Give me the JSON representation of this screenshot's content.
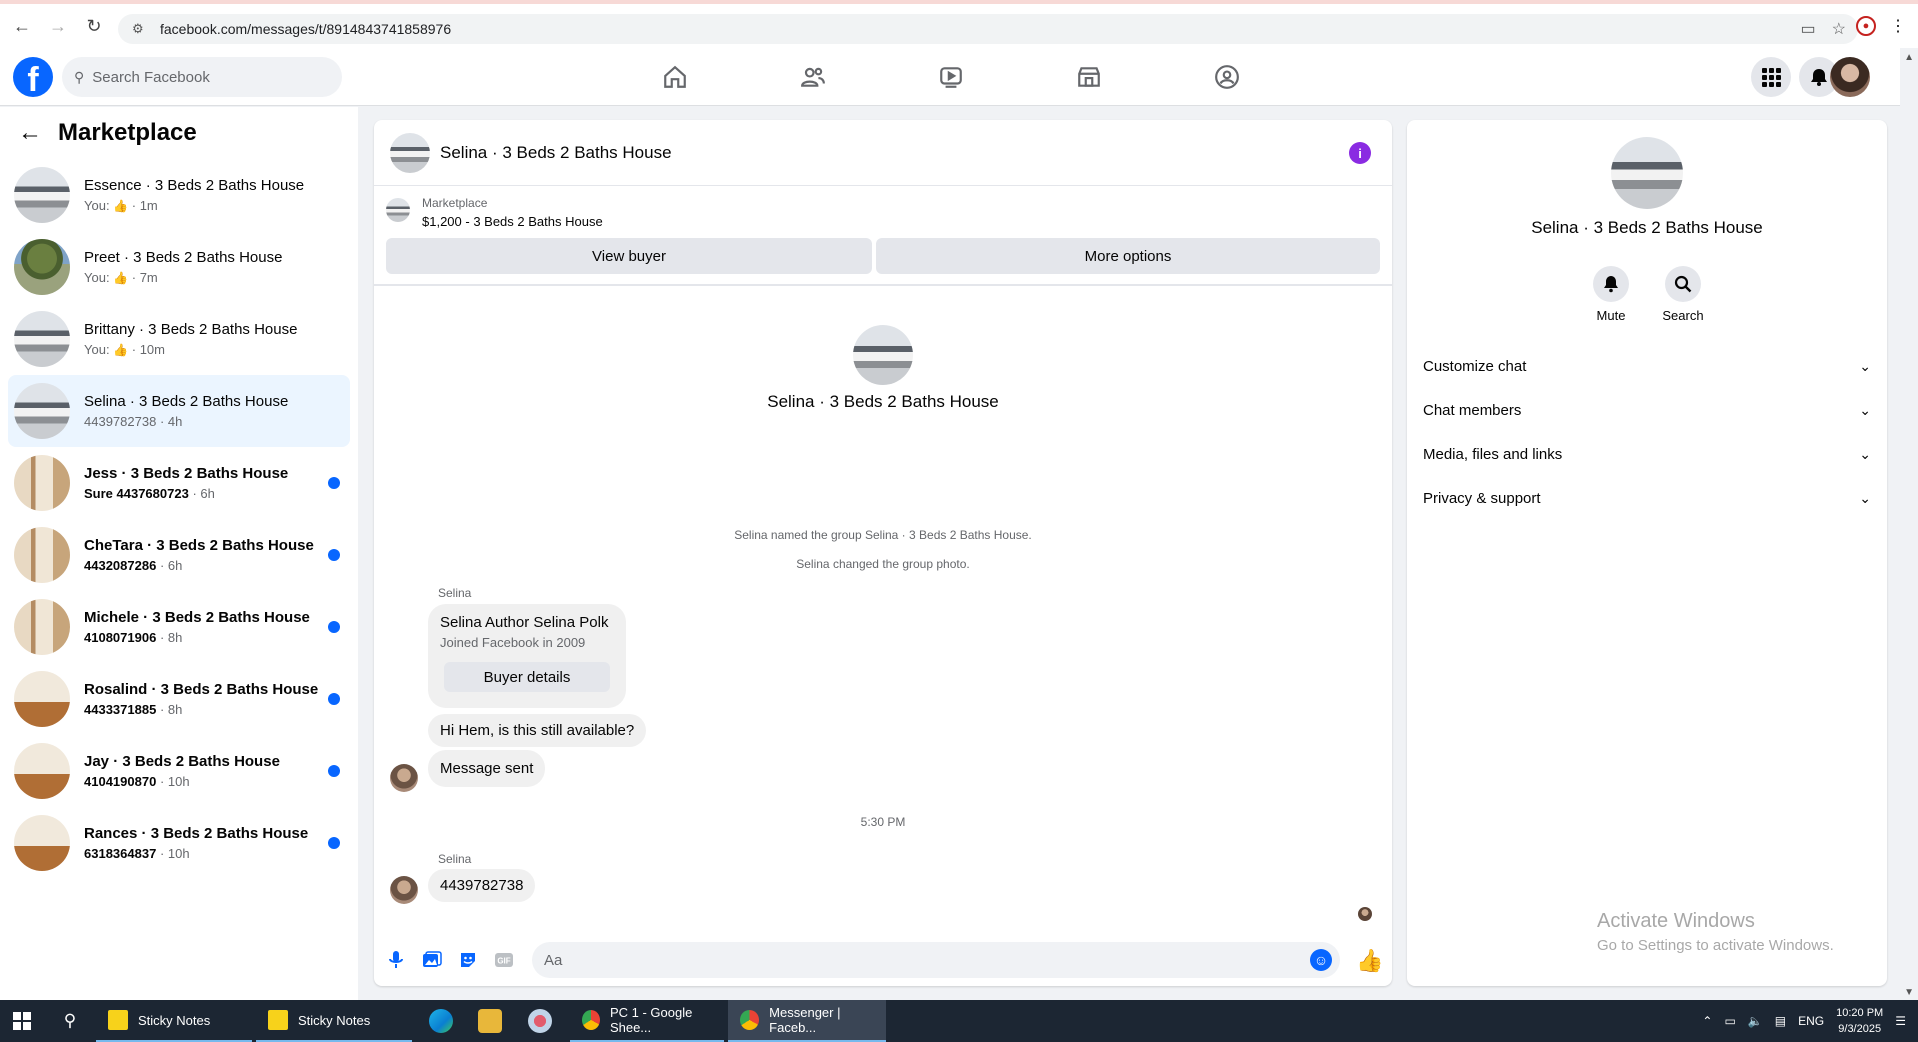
{
  "browser": {
    "url": "facebook.com/messages/t/8914843741858976"
  },
  "fb": {
    "search_placeholder": "Search Facebook"
  },
  "sidebar": {
    "title": "Marketplace",
    "conversations": [
      {
        "title": "Essence · 3 Beds 2 Baths House",
        "prefix": "You:",
        "time": "· 1m",
        "has_thumb": true
      },
      {
        "title": "Preet · 3 Beds 2 Baths House",
        "prefix": "You:",
        "time": "· 7m",
        "has_thumb": true
      },
      {
        "title": "Brittany · 3 Beds 2 Baths House",
        "prefix": "You:",
        "time": "· 10m",
        "has_thumb": true
      },
      {
        "title": "Selina · 3 Beds 2 Baths House",
        "prefix": "4439782738",
        "time": "· 4h"
      },
      {
        "title": "Jess · 3 Beds 2 Baths House",
        "prefix": "Sure 4437680723",
        "time": "· 6h"
      },
      {
        "title": "CheTara · 3 Beds 2 Baths House",
        "prefix": "4432087286",
        "time": "· 6h"
      },
      {
        "title": "Michele · 3 Beds 2 Baths House",
        "prefix": "4108071906",
        "time": "· 8h"
      },
      {
        "title": "Rosalind · 3 Beds 2 Baths House",
        "prefix": "4433371885",
        "time": "· 8h"
      },
      {
        "title": "Jay · 3 Beds 2 Baths House",
        "prefix": "4104190870",
        "time": "· 10h"
      },
      {
        "title": "Rances · 3 Beds 2 Baths House",
        "prefix": "6318364837",
        "time": "· 10h"
      }
    ]
  },
  "chat": {
    "title": "Selina · 3 Beds 2 Baths House",
    "marketplace_label": "Marketplace",
    "marketplace_item": "$1,200 - 3 Beds 2 Baths House",
    "view_buyer": "View buyer",
    "more_options": "More options",
    "center_name": "Selina · 3 Beds 2 Baths House",
    "sys_renamed": "Selina named the group Selina · 3 Beds 2 Baths House.",
    "sys_photo": "Selina changed the group photo.",
    "sender_1": "Selina",
    "card_title": "Selina Author Selina Polk",
    "card_sub": "Joined Facebook in 2009",
    "card_button": "Buyer details",
    "msg_1": "Hi Hem, is this still available?",
    "msg_2": "Message sent",
    "time_sep": "5:30 PM",
    "sender_2": "Selina",
    "msg_3": "4439782738",
    "composer_placeholder": "Aa"
  },
  "info": {
    "name": "Selina · 3 Beds 2 Baths House",
    "mute": "Mute",
    "search": "Search",
    "rows": [
      "Customize chat",
      "Chat members",
      "Media, files and links",
      "Privacy & support"
    ]
  },
  "watermark": {
    "line1": "Activate Windows",
    "line2": "Go to Settings to activate Windows."
  },
  "taskbar": {
    "apps": [
      "Sticky Notes",
      "Sticky Notes",
      "PC 1 - Google Shee...",
      "Messenger | Faceb..."
    ],
    "lang": "ENG",
    "time": "10:20 PM",
    "date": "9/3/2025"
  },
  "colors": {
    "fb_blue": "#0866ff",
    "active_conv": "#ebf5ff",
    "info_purple": "#8a2be2"
  }
}
